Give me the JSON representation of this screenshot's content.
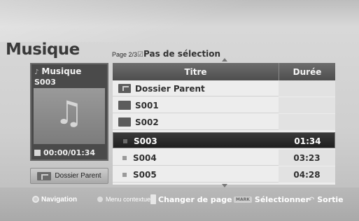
{
  "header": {
    "title": "Musique",
    "page_indicator": "Page 2/3",
    "selection_status": "Pas de sélection"
  },
  "player": {
    "label": "Musique",
    "track": "S003",
    "time": "00:00/01:34"
  },
  "parent_button": {
    "label": "Dossier Parent"
  },
  "table": {
    "columns": [
      "Titre",
      "Durée"
    ],
    "rows": [
      {
        "name": "Dossier Parent",
        "duration": "",
        "type": "parent-folder",
        "selected": false
      },
      {
        "name": "S001",
        "duration": "",
        "type": "folder",
        "selected": false
      },
      {
        "name": "S002",
        "duration": "",
        "type": "folder",
        "selected": false
      },
      {
        "name": "S003",
        "duration": "01:34",
        "type": "file",
        "selected": true
      },
      {
        "name": "S004",
        "duration": "03:23",
        "type": "file",
        "selected": false
      },
      {
        "name": "S005",
        "duration": "04:28",
        "type": "file",
        "selected": false
      }
    ]
  },
  "footer": {
    "navigation": "Navigation",
    "menu": "Menu contextuel",
    "change_page": "Changer de page",
    "mark_badge": "MARK",
    "select": "Sélectionner",
    "exit": "Sortie"
  },
  "icons": {
    "music": "music-note-icon",
    "folder": "folder-icon",
    "nav": "navigation-icon"
  }
}
